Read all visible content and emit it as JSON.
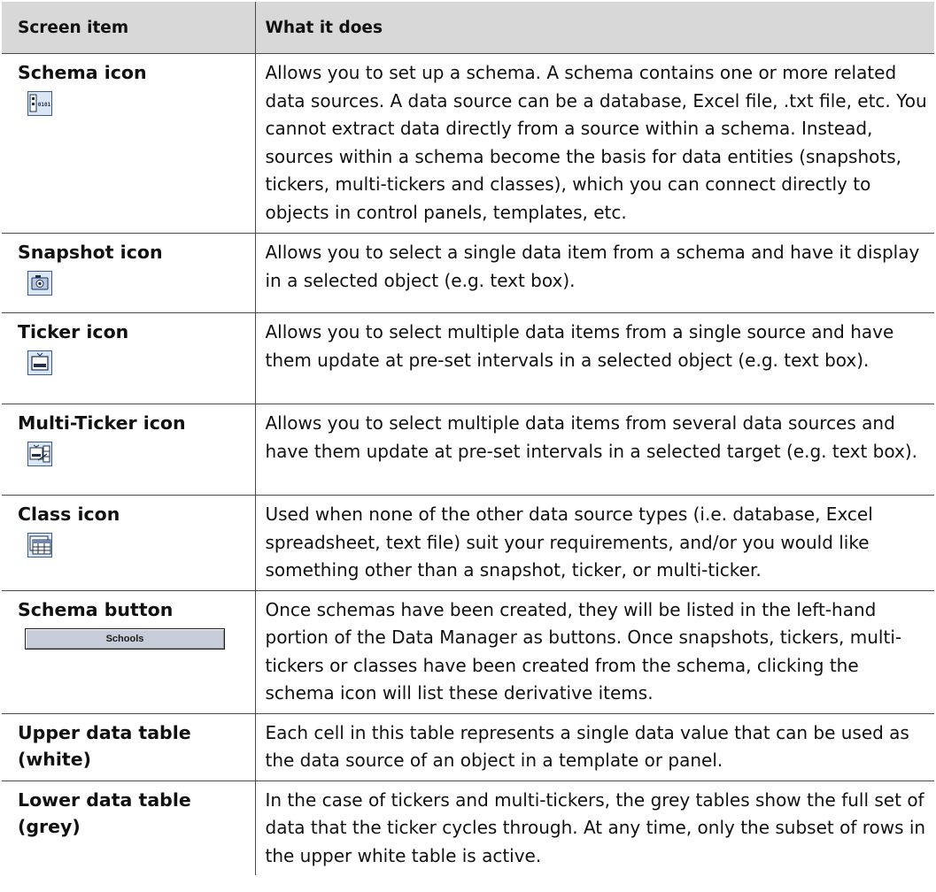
{
  "table": {
    "headers": {
      "item": "Screen item",
      "does": "What it does"
    },
    "rows": [
      {
        "item": "Schema icon",
        "icon": "schema-icon",
        "desc": "Allows you to set up a schema. A schema contains one or more related data sources. A data source can be a database, Excel file, .txt file, etc. You cannot extract data directly from a source within a schema. Instead, sources within a schema become the basis for data entities (snapshots, tickers, multi-tickers and classes), which you can connect directly to objects in control panels, templates, etc."
      },
      {
        "item": "Snapshot icon",
        "icon": "camera-icon",
        "desc": "Allows you to select a single data item from a schema and have it display in a selected object (e.g. text box)."
      },
      {
        "item": "Ticker icon",
        "icon": "ticker-icon",
        "desc": "Allows you to select multiple data items from a single source and have them update at pre-set intervals in a selected object (e.g. text box)."
      },
      {
        "item": "Multi-Ticker icon",
        "icon": "multi-ticker-icon",
        "desc": "Allows you to select multiple data items from several data sources and have them update at pre-set intervals in a selected target (e.g. text box)."
      },
      {
        "item": "Class icon",
        "icon": "class-icon",
        "desc": "Used when none of the other data source types (i.e. database, Excel spreadsheet, text file) suit your requirements, and/or you would like something other than a snapshot, ticker, or multi-ticker."
      },
      {
        "item": "Schema button",
        "button_label": "Schools",
        "desc": "Once schemas have been created, they will be listed in the left-hand portion of the Data Manager as buttons. Once snapshots, tickers, multi-tickers or classes have been created from the schema, clicking the schema icon will list these derivative items."
      },
      {
        "item": "Upper data table (white)",
        "desc": "Each cell in this table represents a single data value that can be used as the data source of an object in a template or panel."
      },
      {
        "item": "Lower data table (grey)",
        "desc": "In the case of tickers and multi-tickers, the grey tables show the full set of data that the ticker cycles through. At any time, only the subset of rows in the upper white table is active."
      }
    ]
  },
  "schema_icon_text": "0101",
  "colors": {
    "header_bg": "#d8d8d8",
    "rule": "#4a4a4a",
    "icon_fill": "#dbe6f4",
    "icon_border": "#3a5a8c"
  }
}
